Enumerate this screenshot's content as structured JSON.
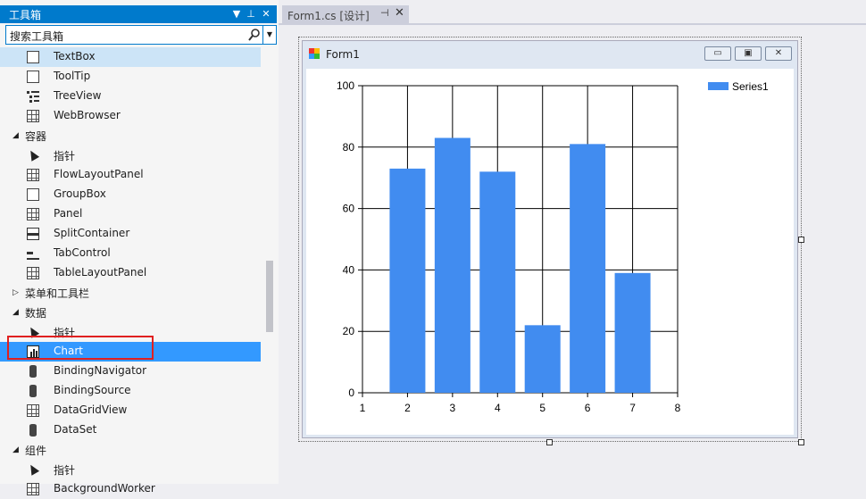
{
  "toolbox": {
    "title": "工具箱",
    "pin": "▾",
    "pin2": "ᵖ",
    "close": "✕",
    "search_value": "搜索工具箱",
    "items": [
      {
        "type": "item",
        "label": "TextBox",
        "state": "sel-light",
        "icon": "textbox-icon",
        "icls": "ico-box"
      },
      {
        "type": "item",
        "label": "ToolTip",
        "icon": "tooltip-icon",
        "icls": "ico-box"
      },
      {
        "type": "item",
        "label": "TreeView",
        "icon": "treeview-icon",
        "icls": "ico-tree"
      },
      {
        "type": "item",
        "label": "WebBrowser",
        "icon": "webbrowser-icon",
        "icls": "ico-grid"
      },
      {
        "type": "cat",
        "label": "容器",
        "expanded": true
      },
      {
        "type": "item",
        "label": "指针",
        "icon": "pointer-icon",
        "icls": "ico-ptr"
      },
      {
        "type": "item",
        "label": "FlowLayoutPanel",
        "icon": "flowlayoutpanel-icon",
        "icls": "ico-grid"
      },
      {
        "type": "item",
        "label": "GroupBox",
        "icon": "groupbox-icon",
        "icls": "ico-box"
      },
      {
        "type": "item",
        "label": "Panel",
        "icon": "panel-icon",
        "icls": "ico-grid"
      },
      {
        "type": "item",
        "label": "SplitContainer",
        "icon": "splitcontainer-icon",
        "icls": "ico-split"
      },
      {
        "type": "item",
        "label": "TabControl",
        "icon": "tabcontrol-icon",
        "icls": "ico-tab"
      },
      {
        "type": "item",
        "label": "TableLayoutPanel",
        "icon": "tablelayoutpanel-icon",
        "icls": "ico-grid"
      },
      {
        "type": "cat",
        "label": "菜单和工具栏",
        "expanded": false
      },
      {
        "type": "cat",
        "label": "数据",
        "expanded": true
      },
      {
        "type": "item",
        "label": "指针",
        "icon": "pointer-icon",
        "icls": "ico-ptr"
      },
      {
        "type": "item",
        "label": "Chart",
        "state": "sel",
        "icon": "chart-icon",
        "icls": "ico-chart"
      },
      {
        "type": "item",
        "label": "BindingNavigator",
        "icon": "bindingnavigator-icon",
        "icls": "ico-db"
      },
      {
        "type": "item",
        "label": "BindingSource",
        "icon": "bindingsource-icon",
        "icls": "ico-db"
      },
      {
        "type": "item",
        "label": "DataGridView",
        "icon": "datagridview-icon",
        "icls": "ico-grid"
      },
      {
        "type": "item",
        "label": "DataSet",
        "icon": "dataset-icon",
        "icls": "ico-db"
      },
      {
        "type": "cat",
        "label": "组件",
        "expanded": true
      },
      {
        "type": "item",
        "label": "指针",
        "icon": "pointer-icon",
        "icls": "ico-ptr"
      },
      {
        "type": "item",
        "label": "BackgroundWorker",
        "icon": "backgroundworker-icon",
        "icls": "ico-grid"
      }
    ],
    "cat_expanded_glyph": "◢",
    "cat_collapsed_glyph": "▷"
  },
  "document": {
    "tab_label": "Form1.cs [设计]",
    "tab_pin": "⊣",
    "tab_close": "✕",
    "form_title": "Form1",
    "min_label": "▭",
    "max_label": "▣",
    "close_label": "✕"
  },
  "chart_data": {
    "type": "bar",
    "x": [
      2,
      3,
      4,
      5,
      6,
      7
    ],
    "series": [
      {
        "name": "Series1",
        "values": [
          73,
          83,
          72,
          22,
          81,
          39
        ]
      }
    ],
    "xlim": [
      1,
      8
    ],
    "ylim": [
      0,
      100
    ],
    "xticks": [
      "1",
      "2",
      "3",
      "4",
      "5",
      "6",
      "7",
      "8"
    ],
    "yticks": [
      "0",
      "20",
      "40",
      "60",
      "80",
      "100"
    ],
    "grid": true,
    "legend": "top-right",
    "color": "#418cf0"
  }
}
